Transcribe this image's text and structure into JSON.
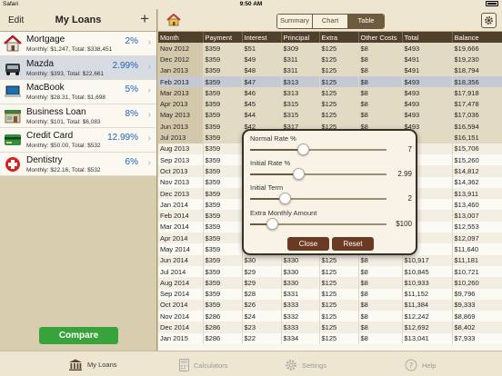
{
  "status": {
    "carrier": "Safari",
    "time": "9:50 AM"
  },
  "left_nav": {
    "edit": "Edit",
    "title": "My Loans",
    "add": "+"
  },
  "loans": [
    {
      "name": "Mortgage",
      "rate": "2%",
      "detail": "Monthly: $1,247, Total: $338,451",
      "icon": "house-icon"
    },
    {
      "name": "Mazda",
      "rate": "2.99%",
      "detail": "Monthly: $393, Total: $22,661",
      "icon": "car-icon"
    },
    {
      "name": "MacBook",
      "rate": "5%",
      "detail": "Monthly: $28.31, Total: $1,698",
      "icon": "laptop-icon"
    },
    {
      "name": "Business Loan",
      "rate": "8%",
      "detail": "Monthly: $101, Total: $6,083",
      "icon": "store-icon"
    },
    {
      "name": "Credit Card",
      "rate": "12.99%",
      "detail": "Monthly: $50.00, Total: $532",
      "icon": "credit-card-icon"
    },
    {
      "name": "Dentistry",
      "rate": "6%",
      "detail": "Monthly: $22.16, Total: $532",
      "icon": "red-cross-icon"
    }
  ],
  "compare_label": "Compare",
  "segments": [
    "Summary",
    "Chart",
    "Table"
  ],
  "table": {
    "headers": [
      "Month",
      "Payment",
      "Interest",
      "Principal",
      "Extra",
      "Other Costs",
      "Total",
      "Balance"
    ],
    "rows": [
      [
        "Nov 2012",
        "$359",
        "$51",
        "$309",
        "$125",
        "$8",
        "$493",
        "$19,666"
      ],
      [
        "Dec 2012",
        "$359",
        "$49",
        "$311",
        "$125",
        "$8",
        "$491",
        "$19,230"
      ],
      [
        "Jan 2013",
        "$359",
        "$48",
        "$311",
        "$125",
        "$8",
        "$491",
        "$18,794"
      ],
      [
        "Feb 2013",
        "$359",
        "$47",
        "$313",
        "$125",
        "$8",
        "$493",
        "$18,356"
      ],
      [
        "Mar 2013",
        "$359",
        "$46",
        "$313",
        "$125",
        "$8",
        "$493",
        "$17,918"
      ],
      [
        "Apr 2013",
        "$359",
        "$45",
        "$315",
        "$125",
        "$8",
        "$493",
        "$17,478"
      ],
      [
        "May 2013",
        "$359",
        "$44",
        "$315",
        "$125",
        "$8",
        "$493",
        "$17,036"
      ],
      [
        "Jun 2013",
        "$359",
        "$42",
        "$317",
        "$125",
        "$8",
        "$493",
        "$16,594"
      ],
      [
        "Jul 2013",
        "$359",
        "",
        "",
        "",
        "",
        "",
        "$16,151"
      ],
      [
        "Aug 2013",
        "$359",
        "",
        "",
        "",
        "",
        "",
        "$15,706"
      ],
      [
        "Sep 2013",
        "$359",
        "",
        "",
        "",
        "",
        "",
        "$15,260"
      ],
      [
        "Oct 2013",
        "$359",
        "",
        "",
        "",
        "",
        "",
        "$14,812"
      ],
      [
        "Nov 2013",
        "$359",
        "",
        "",
        "",
        "",
        "",
        "$14,362"
      ],
      [
        "Dec 2013",
        "$359",
        "",
        "",
        "",
        "",
        "",
        "$13,911"
      ],
      [
        "Jan 2014",
        "$359",
        "",
        "",
        "",
        "",
        "",
        "$13,460"
      ],
      [
        "Feb 2014",
        "$359",
        "",
        "",
        "",
        "",
        "",
        "$13,007"
      ],
      [
        "Mar 2014",
        "$359",
        "",
        "",
        "",
        "",
        "",
        "$12,553"
      ],
      [
        "Apr 2014",
        "$359",
        "",
        "",
        "",
        "",
        "",
        "$12,097"
      ],
      [
        "May 2014",
        "$359",
        "",
        "",
        "",
        "",
        "",
        "$11,640"
      ],
      [
        "Jun 2014",
        "$359",
        "$30",
        "$330",
        "$125",
        "$8",
        "$10,917",
        "$11,181"
      ],
      [
        "Jul 2014",
        "$359",
        "$29",
        "$330",
        "$125",
        "$8",
        "$10,845",
        "$10,721"
      ],
      [
        "Aug 2014",
        "$359",
        "$29",
        "$330",
        "$125",
        "$8",
        "$10,933",
        "$10,260"
      ],
      [
        "Sep 2014",
        "$359",
        "$28",
        "$331",
        "$125",
        "$8",
        "$11,152",
        "$9,796"
      ],
      [
        "Oct 2014",
        "$359",
        "$26",
        "$333",
        "$125",
        "$8",
        "$11,384",
        "$9,333"
      ],
      [
        "Nov 2014",
        "$286",
        "$24",
        "$332",
        "$125",
        "$8",
        "$12,242",
        "$8,869"
      ],
      [
        "Dec 2014",
        "$286",
        "$23",
        "$333",
        "$125",
        "$8",
        "$12,692",
        "$8,402"
      ],
      [
        "Jan 2015",
        "$286",
        "$22",
        "$334",
        "$125",
        "$8",
        "$13,041",
        "$7,933"
      ]
    ]
  },
  "popup": {
    "sliders": [
      {
        "label": "Normal Rate %",
        "value": "7",
        "level": 0.38
      },
      {
        "label": "Initial Rate %",
        "value": "2.99",
        "level": 0.34
      },
      {
        "label": "Initial Term",
        "value": "2",
        "level": 0.23
      },
      {
        "label": "Extra Monthly Amount",
        "value": "$100",
        "level": 0.13
      }
    ],
    "close": "Close",
    "reset": "Reset"
  },
  "tabs": [
    {
      "label": "My Loans",
      "icon": "bank-icon"
    },
    {
      "label": "Calculators",
      "icon": "calculator-icon"
    },
    {
      "label": "Settings",
      "icon": "gear-icon"
    },
    {
      "label": "Help",
      "icon": "help-icon"
    }
  ],
  "colors": {
    "accent": "#6e5a3c",
    "rate_blue": "#1e62b8",
    "compare_green": "#38a33a",
    "header_brown": "#4f3f2b"
  }
}
